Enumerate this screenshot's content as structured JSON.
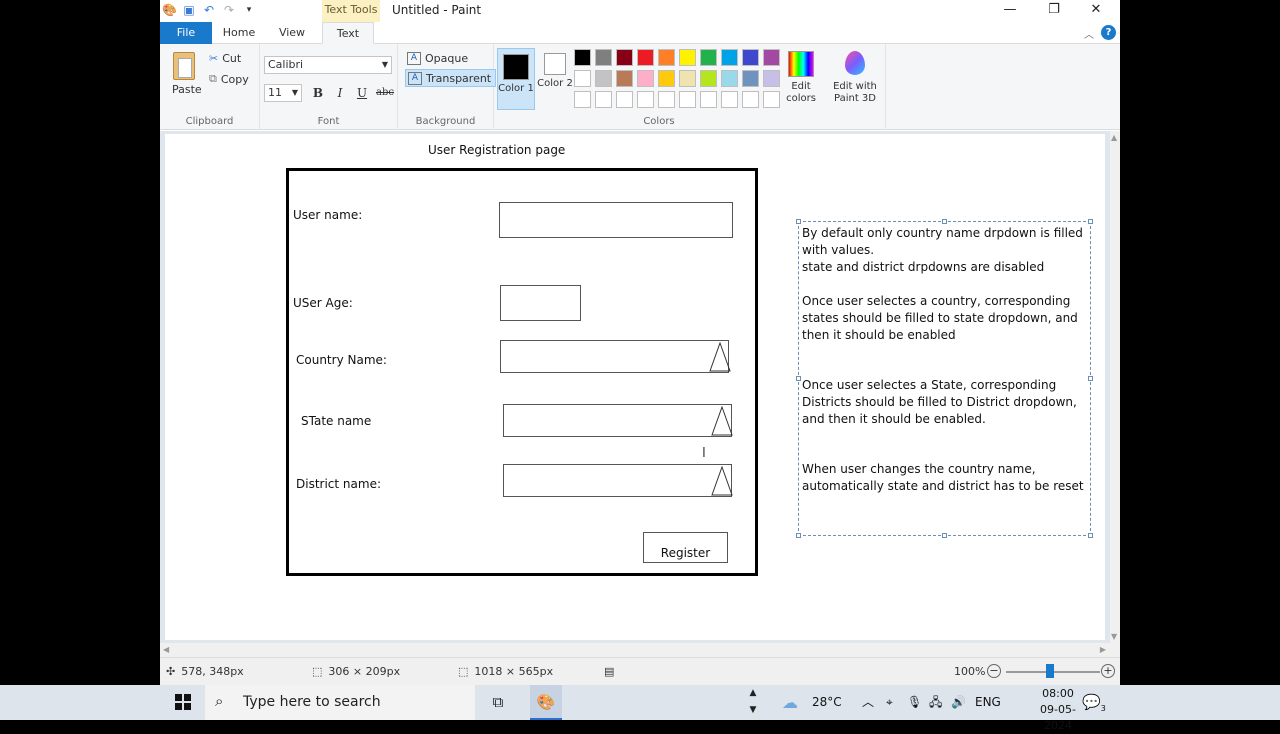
{
  "window": {
    "title": "Untitled - Paint",
    "context_tab": "Text Tools",
    "controls": {
      "minimize": "—",
      "restore": "❐",
      "close": "✕"
    }
  },
  "tabs": [
    {
      "label": "File"
    },
    {
      "label": "Home"
    },
    {
      "label": "View"
    },
    {
      "label": "Text"
    }
  ],
  "ribbon": {
    "clipboard": {
      "paste": "Paste",
      "cut": "Cut",
      "copy": "Copy",
      "group": "Clipboard"
    },
    "font": {
      "family": "Calibri",
      "size": "11",
      "bold": "B",
      "italic": "I",
      "underline": "U",
      "strike": "abc",
      "group": "Font"
    },
    "background": {
      "opaque": "Opaque",
      "transparent": "Transparent",
      "group": "Background"
    },
    "colors": {
      "color1_label": "Color 1",
      "color2_label": "Color 2",
      "color1": "#000000",
      "color2": "#ffffff",
      "edit_colors": "Edit colors",
      "edit_paint3d": "Edit with Paint 3D",
      "group": "Colors",
      "palette": [
        "#000000",
        "#7f7f7f",
        "#880015",
        "#ed1c24",
        "#ff7f27",
        "#fff200",
        "#22b14c",
        "#00a2e8",
        "#3f48cc",
        "#a349a4",
        "#ffffff",
        "#c3c3c3",
        "#b97a57",
        "#ffaec9",
        "#ffc90e",
        "#efe4b0",
        "#b5e61d",
        "#99d9ea",
        "#7092be",
        "#c8bfe7",
        "#ffffff",
        "#ffffff",
        "#ffffff",
        "#ffffff",
        "#ffffff",
        "#ffffff",
        "#ffffff",
        "#ffffff",
        "#ffffff",
        "#ffffff"
      ]
    }
  },
  "drawing": {
    "title": "User Registration page",
    "labels": {
      "user_name": "User name:",
      "user_age": "USer Age:",
      "country": "Country Name:",
      "state": "STate name",
      "district": "District name:"
    },
    "register": "Register",
    "notes": [
      "By default only country name drpdown is filled with values.",
      "state and district drpdowns are disabled",
      "Once user selectes a country, corresponding states should be filled to state dropdown, and then it should be enabled",
      "Once user selectes a State, corresponding Districts should be filled to District dropdown, and then it should be enabled.",
      "When user changes the country name, automatically state and district has to be reset"
    ]
  },
  "statusbar": {
    "cursor_pos": "578, 348px",
    "selection_size": "306 × 209px",
    "canvas_size": "1018 × 565px",
    "zoom": "100%"
  },
  "taskbar": {
    "search_placeholder": "Type here to search",
    "weather": "28°C",
    "language": "ENG",
    "time": "08:00",
    "date": "09-05-2024",
    "notification_count": "3"
  }
}
